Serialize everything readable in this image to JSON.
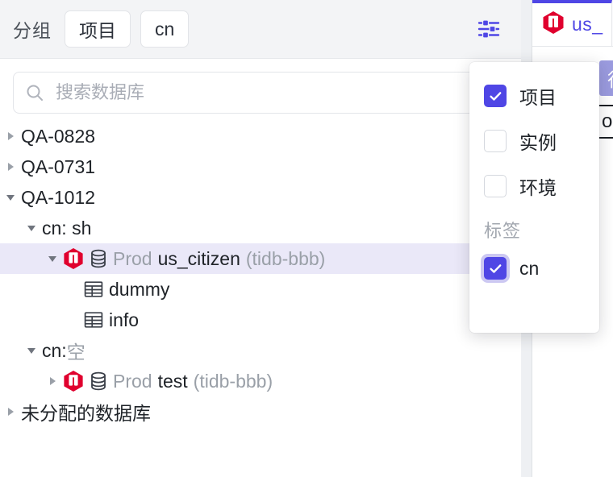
{
  "header": {
    "group_label": "分组",
    "chips": [
      {
        "label": "项目",
        "name": "chip-project"
      },
      {
        "label": "cn",
        "name": "chip-cn"
      }
    ],
    "filter_icon": "sliders-filter-icon"
  },
  "search": {
    "placeholder": "搜索数据库",
    "value": "",
    "icon": "search-icon"
  },
  "tree": {
    "nodes": [
      {
        "label": "QA-0828",
        "indent": 0,
        "twisty": "collapsed",
        "icons": [],
        "suffix": ""
      },
      {
        "label": "QA-0731",
        "indent": 0,
        "twisty": "collapsed",
        "icons": [],
        "suffix": ""
      },
      {
        "label": "QA-1012",
        "indent": 0,
        "twisty": "expanded",
        "icons": [],
        "suffix": ""
      },
      {
        "label": "cn: sh",
        "indent": 1,
        "twisty": "expanded",
        "icons": [],
        "suffix": ""
      },
      {
        "label": "us_citizen",
        "indent": 2,
        "twisty": "expanded",
        "icons": [
          "tidb-logo-icon",
          "database-icon"
        ],
        "env": "Prod",
        "suffix": "(tidb-bbb)",
        "selected": true
      },
      {
        "label": "dummy",
        "indent": 3,
        "twisty": "none",
        "icons": [
          "table-icon"
        ],
        "suffix": ""
      },
      {
        "label": "info",
        "indent": 3,
        "twisty": "none",
        "icons": [
          "table-icon"
        ],
        "suffix": ""
      },
      {
        "label": "cn: ",
        "indent": 1,
        "twisty": "expanded",
        "icons": [],
        "muted_suffix": "空",
        "suffix": ""
      },
      {
        "label": "test",
        "indent": 2,
        "twisty": "collapsed",
        "icons": [
          "tidb-logo-icon",
          "database-icon"
        ],
        "env": "Prod",
        "suffix": "(tidb-bbb)"
      },
      {
        "label": "未分配的数据库",
        "indent": 0,
        "twisty": "collapsed",
        "icons": [],
        "suffix": ""
      }
    ]
  },
  "dropdown": {
    "items": [
      {
        "label": "项目",
        "checked": true,
        "focused": false,
        "name": "dropdown-checkbox-project"
      },
      {
        "label": "实例",
        "checked": false,
        "focused": false,
        "name": "dropdown-checkbox-instance"
      },
      {
        "label": "环境",
        "checked": false,
        "focused": false,
        "name": "dropdown-checkbox-environment"
      }
    ],
    "section_label": "标签",
    "tags": [
      {
        "label": "cn",
        "checked": true,
        "focused": true,
        "name": "dropdown-checkbox-tag-cn"
      }
    ]
  },
  "right_pane": {
    "tab_label": "us_",
    "tab_icon": "tidb-logo-icon",
    "run_button_label": "行",
    "result_text": "oo"
  },
  "colors": {
    "accent": "#4f46e5",
    "selected_row": "#eae8f8",
    "header_bg": "#f3f4f6",
    "muted_text": "#9aa0a8",
    "tidb_red": "#e0002e",
    "run_button": "#9b9bdf"
  }
}
